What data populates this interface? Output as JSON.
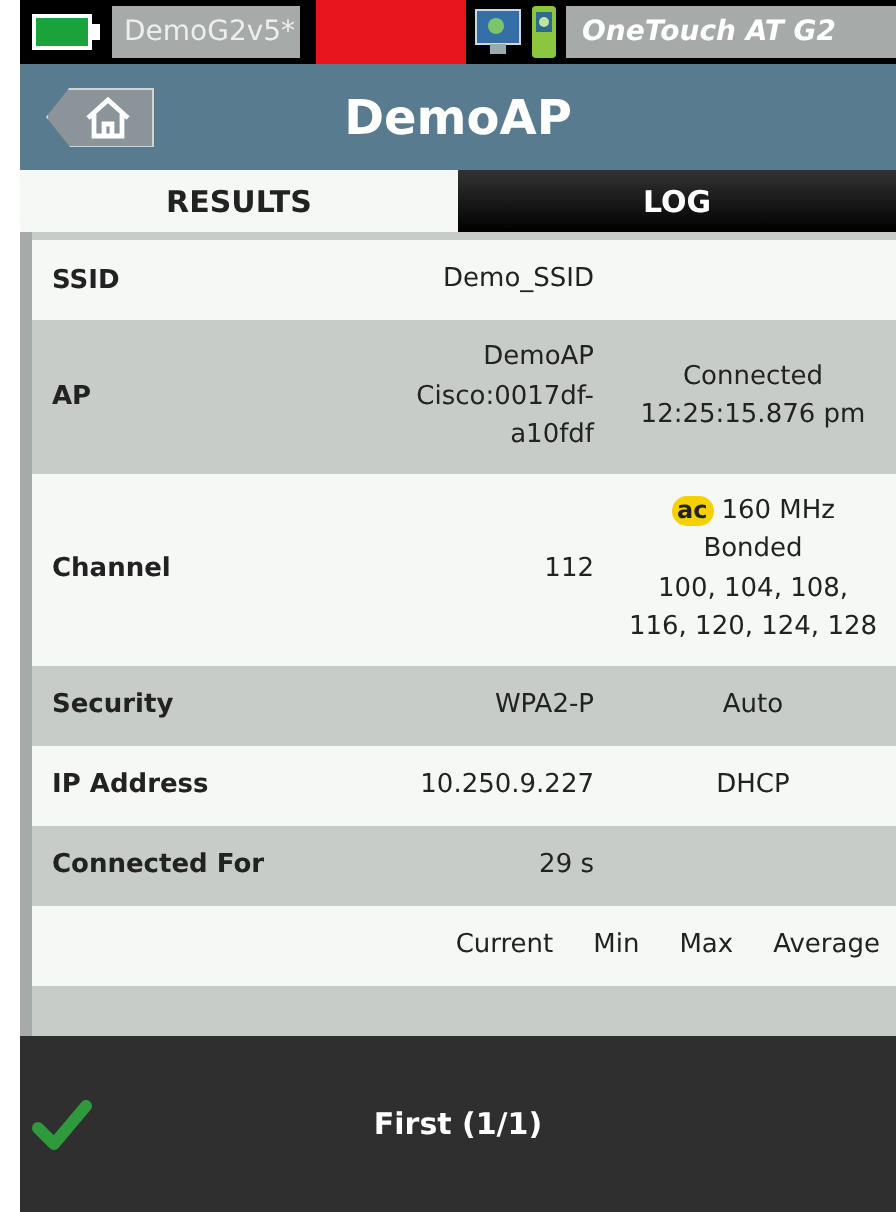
{
  "status_bar": {
    "profile": "DemoG2v5*",
    "device": "OneTouch AT G2"
  },
  "header": {
    "title": "DemoAP"
  },
  "tabs": [
    {
      "label": "RESULTS",
      "selected": true
    },
    {
      "label": "LOG",
      "selected": false
    }
  ],
  "rows": [
    {
      "label": "SSID",
      "value": [
        "Demo_SSID"
      ],
      "detail": []
    },
    {
      "label": "AP",
      "value": [
        "DemoAP",
        "Cisco:0017df-",
        "a10fdf"
      ],
      "detail": [
        "Connected",
        "12:25:15.876 pm"
      ]
    },
    {
      "label": "Channel",
      "value": [
        "112"
      ],
      "badge": "ac",
      "detail": [
        "160 MHz",
        "Bonded",
        "100, 104, 108,",
        "116, 120, 124, 128"
      ]
    },
    {
      "label": "Security",
      "value": [
        "WPA2-P"
      ],
      "detail": [
        "Auto"
      ]
    },
    {
      "label": "IP Address",
      "value": [
        "10.250.9.227"
      ],
      "detail": [
        "DHCP"
      ]
    },
    {
      "label": "Connected For",
      "value": [
        "29 s"
      ],
      "detail": []
    }
  ],
  "stats_columns": [
    "Current",
    "Min",
    "Max",
    "Average"
  ],
  "footer": {
    "label": "First (1/1)"
  }
}
